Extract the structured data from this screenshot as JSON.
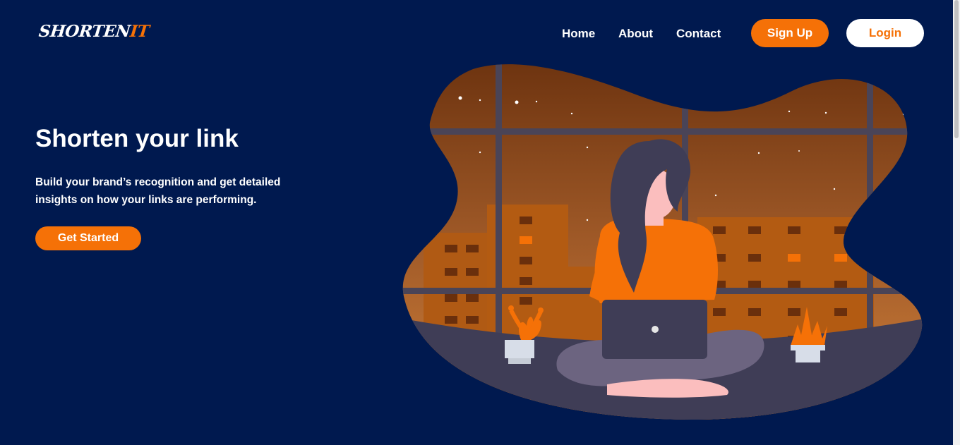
{
  "header": {
    "logo": {
      "part1": "SHORTEN",
      "part2": "IT"
    },
    "nav": [
      {
        "label": "Home"
      },
      {
        "label": "About"
      },
      {
        "label": "Contact"
      }
    ],
    "signup_label": "Sign Up",
    "login_label": "Login"
  },
  "hero": {
    "title": "Shorten your link",
    "subtitle": "Build your brand’s recognition and get detailed insights on how your links are performing.",
    "cta_label": "Get Started"
  },
  "colors": {
    "background": "#00194f",
    "accent": "#f57107",
    "white": "#ffffff"
  },
  "illustration": {
    "name": "woman-with-laptop-at-window-illustration"
  }
}
